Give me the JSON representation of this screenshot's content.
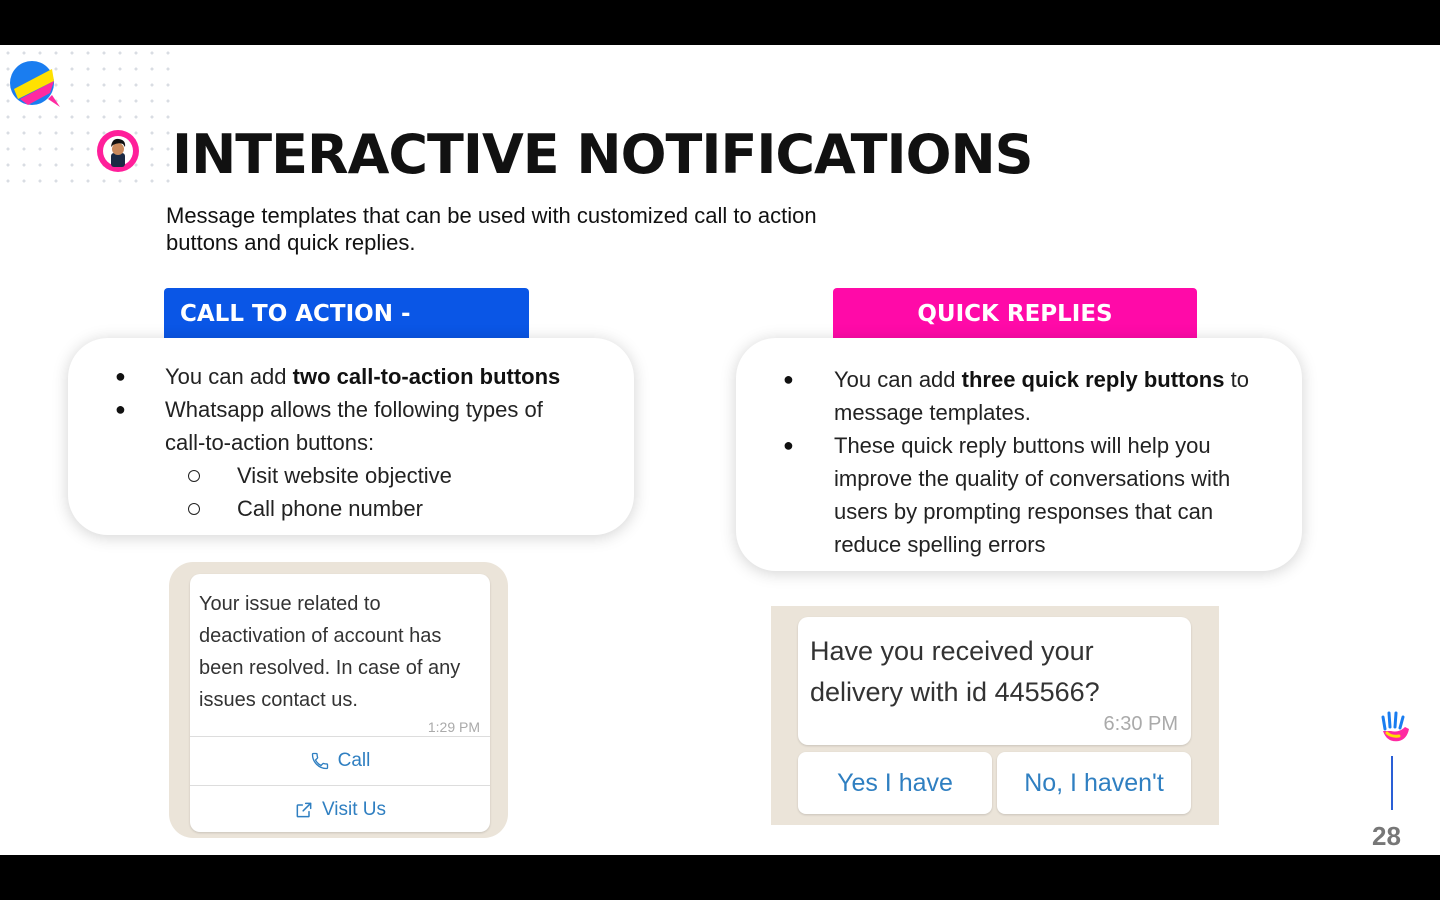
{
  "slide": {
    "title": "INTERACTIVE NOTIFICATIONS",
    "subtitle": "Message templates that can be used with customized call to action buttons and quick replies.",
    "page_number": "28"
  },
  "cta_section": {
    "tab_label": "CALL TO ACTION - BUTTONS",
    "bullet1_prefix": "You can add ",
    "bullet1_bold": "two call-to-action buttons",
    "bullet2_line1": "Whatsapp allows the following types of",
    "bullet2_line2": "call-to-action buttons:",
    "sub1": "Visit website objective",
    "sub2": "Call phone number"
  },
  "qr_section": {
    "tab_label": "QUICK REPLIES",
    "bullet1_prefix": "You can add ",
    "bullet1_bold": "three quick reply buttons",
    "bullet1_suffix": " to",
    "bullet1_line2": "message templates.",
    "bullet2_lines": [
      "These quick reply buttons will help you",
      "improve the quality of conversations with",
      "users by prompting responses that can",
      "reduce spelling errors"
    ]
  },
  "cta_chat": {
    "message": "Your issue related to deactivation of account has been resolved. In case of any issues contact us.",
    "time": "1:29 PM",
    "call_label": "Call",
    "visit_label": "Visit Us"
  },
  "qr_chat": {
    "message": "Have you received your delivery with id 445566?",
    "time": "6:30 PM",
    "yes_label": "Yes I have",
    "no_label": "No, I haven't"
  },
  "colors": {
    "cta_tab": "#0a56e6",
    "qr_tab": "#ff0aa8",
    "link_blue": "#2f7fc1",
    "chat_background": "#ebe4d9"
  },
  "icons": [
    "brand-logo-icon",
    "avatar-icon",
    "phone-icon",
    "external-link-icon",
    "hand-icon"
  ]
}
